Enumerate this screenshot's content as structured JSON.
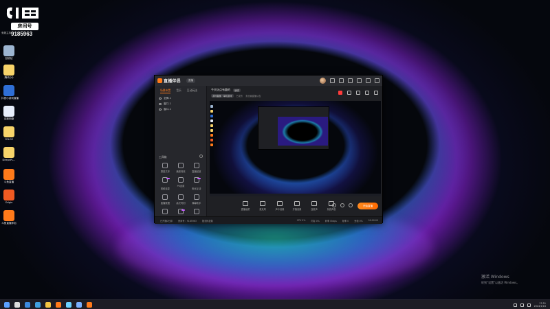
{
  "desktop": {
    "overlay": {
      "room_label": "房间号",
      "room_number": "9185963",
      "caption": "来超主持"
    },
    "icons": [
      {
        "label": "回收站",
        "color": "#9db5d1"
      },
      {
        "label": "腾讯QQ",
        "color": "#f8d46a"
      },
      {
        "label": "抖音小游戏直播",
        "color": "#2f6fd6"
      },
      {
        "label": "百度网盘",
        "color": "#e7eefb"
      },
      {
        "label": "YOLOE",
        "color": "#f8d46a"
      },
      {
        "label": "DeepsPL...",
        "color": "#f8d46a"
      },
      {
        "label": "斗鱼直播",
        "color": "#ff7a1a"
      },
      {
        "label": "Origin",
        "color": "#f05a22"
      },
      {
        "label": "斗鱼直播伴侣",
        "color": "#ff7a1a"
      }
    ]
  },
  "app": {
    "brand": "直播伴侣",
    "version_badge": "直播",
    "left_tabs": [
      "场景布置",
      "音乐",
      "互动玩法"
    ],
    "sources": [
      "全屏-1",
      "窗口-1",
      "窗口-1"
    ],
    "tools_title": "工具箱",
    "tools": [
      {
        "label": "屏幕共享",
        "badge": false
      },
      {
        "label": "美颜特效",
        "badge": false
      },
      {
        "label": "直播回放",
        "badge": false
      },
      {
        "label": "视频连麦",
        "badge": true
      },
      {
        "label": "PK连麦",
        "badge": false
      },
      {
        "label": "粉丝互动",
        "badge": true
      },
      {
        "label": "直播数据",
        "badge": false
      },
      {
        "label": "高光时刻",
        "badge": false
      },
      {
        "label": "弹幕助手",
        "badge": false
      },
      {
        "label": "主播任务",
        "badge": false
      },
      {
        "label": "更多玩法",
        "badge": true
      },
      {
        "label": "礼物特效",
        "badge": false
      }
    ],
    "preview_header": {
      "title": "今天玩点有趣的",
      "tag": "编辑",
      "chip": "游戏直播 · 单机游戏",
      "hint": "已发布",
      "hint2": "未设置直播公告"
    },
    "controls": [
      "直播画质",
      "麦克风",
      "声卡设置",
      "开播设置",
      "连麦声",
      "系统声音"
    ],
    "live_button": "开始直播",
    "status": {
      "left1": "已开播0分钟",
      "left2": "房间号：9185963",
      "left3": "推流码复制",
      "right": [
        "CPU 0%",
        "内存 0%",
        "码率 0kbps",
        "帧率 0",
        "丢帧 0%",
        "00:00:00"
      ]
    }
  },
  "watermark": {
    "line1": "激活 Windows",
    "line2": "转到“设置”以激活 Windows。"
  },
  "taskbar": {
    "icons": [
      "#5aa0ff",
      "#dddddd",
      "#3d8be0",
      "#40a0e0",
      "#f4c542",
      "#ff7a1a",
      "#6ad1ff",
      "#7ab0ff",
      "#ff7a1a"
    ],
    "time": "17:51",
    "date": "2024/1/16"
  }
}
